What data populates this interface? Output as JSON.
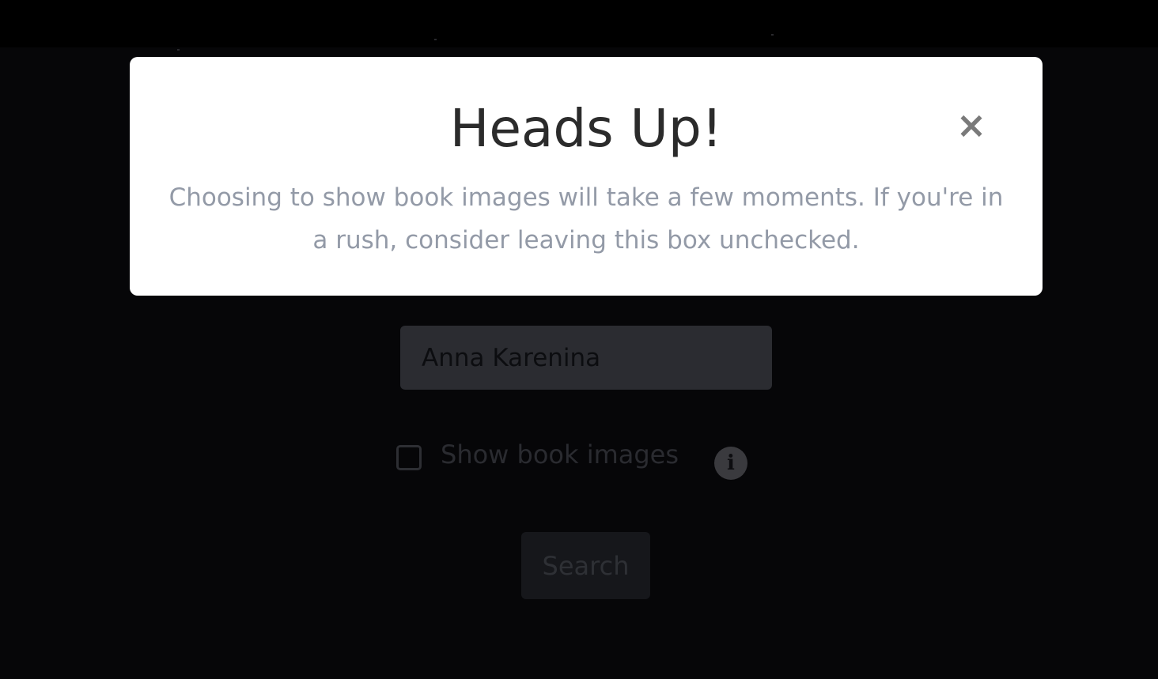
{
  "modal": {
    "title": "Heads Up!",
    "close_label": "×",
    "body": "Choosing to show book images will take a few moments. If you're in a rush, consider leaving this box unchecked."
  },
  "form": {
    "search_value": "Anna Karenina",
    "checkbox_label": "Show book images",
    "checkbox_checked": false,
    "info_icon_glyph": "i",
    "search_button_label": "Search"
  },
  "icons": {
    "close": "close-icon",
    "info": "info-icon"
  },
  "colors": {
    "backdrop": "#060608",
    "modal_bg": "#ffffff",
    "title": "#2b2b2b",
    "body_text": "#939aa7",
    "close_icon": "#7a7a7a"
  }
}
